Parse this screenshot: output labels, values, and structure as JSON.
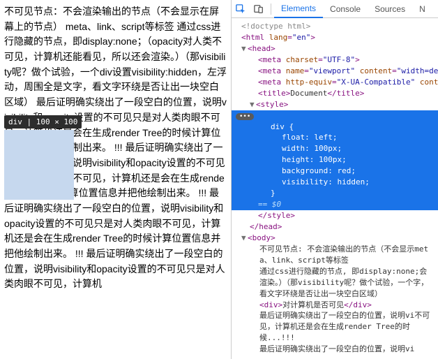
{
  "page": {
    "badge_text": "div | 100 × 100",
    "paragraph": "不可见节点：不会渲染输出的节点（不会显示在屏幕上的节点） meta、link、script等标签 通过css进行隐藏的节点，即display:none；（opacity对人类不可见，计算机还能看见，所以还会渲染。）（那visibility呢？做个试验，一个div设置visibility:hidden，左浮动，周围全是文字，看文字环绕是否让出一块空白区域） 最后证明确实绕出了一段空白的位置，说明visibility和opacity设置的不可见只是对人类肉眼不可见，计算机还是会在生成render Tree的时候计算位置信息并把他绘制出来。 !!! 最后证明确实绕出了一段空白的位置，说明visibility和opacity设置的不可见只是对人类肉眼不可见，计算机还是会在生成render Tree的时候计算位置信息并把他绘制出来。 !!! 最后证明确实绕出了一段空白的位置，说明visibility和opacity设置的不可见只是对人类肉眼不可见，计算机还是会在生成render Tree的时候计算位置信息并把他绘制出来。 !!! 最后证明确实绕出了一段空白的位置，说明visibility和opacity设置的不可见只是对人类肉眼不可见，计算机"
  },
  "toolbar": {
    "tabs": {
      "elements": "Elements",
      "console": "Console",
      "sources": "Sources",
      "network": "N"
    }
  },
  "tree": {
    "doctype": "<!doctype html>",
    "html_open": "html",
    "lang_attr": "lang",
    "lang_val": "\"en\"",
    "head": "head",
    "meta1": {
      "tag": "meta",
      "a": "charset",
      "v": "\"UTF-8\""
    },
    "meta2": {
      "tag": "meta",
      "a1": "name",
      "v1": "\"viewport\"",
      "a2": "content",
      "v2": "\"width=de"
    },
    "meta3": {
      "tag": "meta",
      "a1": "http-equiv",
      "v1": "\"X-UA-Compatible\"",
      "a2": "cont"
    },
    "title_tag": "title",
    "title_text": "Document",
    "style": "style",
    "css_selector": "div {",
    "css_rules": [
      "float: left;",
      "width: 100px;",
      "height: 100px;",
      "background: red;",
      "visibility: hidden;"
    ],
    "css_close": "}",
    "range": "== $0",
    "body": "body",
    "bodytext1": "不可见节点: 不会渲染输出的节点（不会显示meta、link、script等标签",
    "bodytext2": "通过css进行隐藏的节点, 即display:none;会渲染。）（那visibility呢？做个试验，一个字，看文字环绕是否让出一块空白区域）",
    "div_inner": "对计算机是否可见",
    "bodytext3": "最后证明确实绕出了一段空白的位置，说明vi不可见，计算机还是会在生成render Tree的时候...!!!",
    "bodytext4": "最后证明确实绕出了一段空白的位置，说明vi"
  }
}
